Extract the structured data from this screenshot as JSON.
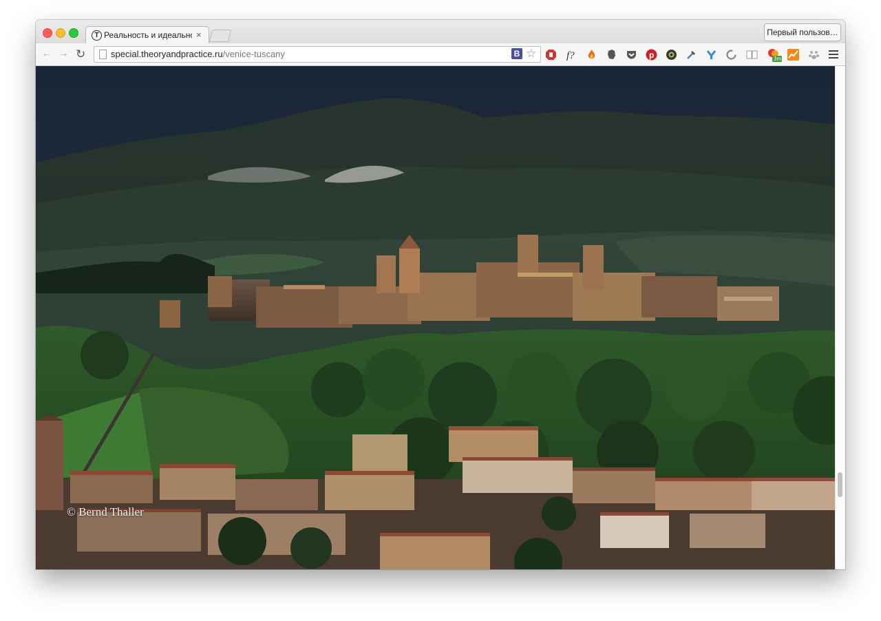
{
  "browser": {
    "tab": {
      "title": "Реальность и идеальност",
      "favicon_letter": "T",
      "close_glyph": "×"
    },
    "profile_button": "Первый пользов…",
    "url_host": "special.theoryandpractice.ru",
    "url_path": "/venice-tuscany",
    "bookmark_ext_letter": "B",
    "extension_badge": "3m"
  },
  "photo": {
    "credit": "© Bernd Thaller"
  },
  "colors": {
    "sky": "#1e2c3a",
    "hills": "#2a3a30",
    "town_wall": "#a27c58",
    "roof": "#8a4a34",
    "accent_tab": "#f6f6f6"
  }
}
